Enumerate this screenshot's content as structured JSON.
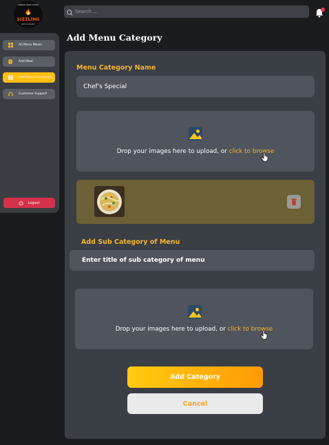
{
  "brand": {
    "tagline": "SIMPLE LONG TASTE",
    "tagline2": "SINCE 2020",
    "name": "SIZZLING",
    "sub": "RESTAURANT"
  },
  "sidebar": {
    "items": [
      {
        "label": "All Menu Meals",
        "icon": "grid-icon",
        "active": false
      },
      {
        "label": "Add Meal",
        "icon": "add-meal-icon",
        "active": false
      },
      {
        "label": "Add Menu Categories",
        "icon": "list-icon",
        "active": true
      },
      {
        "label": "Customer Support",
        "icon": "headset-icon",
        "active": false
      }
    ],
    "logout_label": "Logout"
  },
  "header": {
    "search_placeholder": "Search ...",
    "notification_count": ""
  },
  "page": {
    "title": "Add Menu Category"
  },
  "form": {
    "category_label": "Menu Category Name",
    "category_value": "Chef's Special",
    "upload1": {
      "text": "Drop your images here to upload, or ",
      "link": "click to browse"
    },
    "sub_label": "Add Sub Category of Menu",
    "sub_placeholder": "Enter title of sub category of menu",
    "upload2": {
      "text": "Drop your images here to upload, or ",
      "link": "click to browse"
    },
    "add_label": "Add Category",
    "cancel_label": "Cancel"
  },
  "colors": {
    "accent": "#f5b52e",
    "active_nav": "#ffbe12",
    "logout": "#d3324a",
    "preview_bg": "#6c6136"
  }
}
